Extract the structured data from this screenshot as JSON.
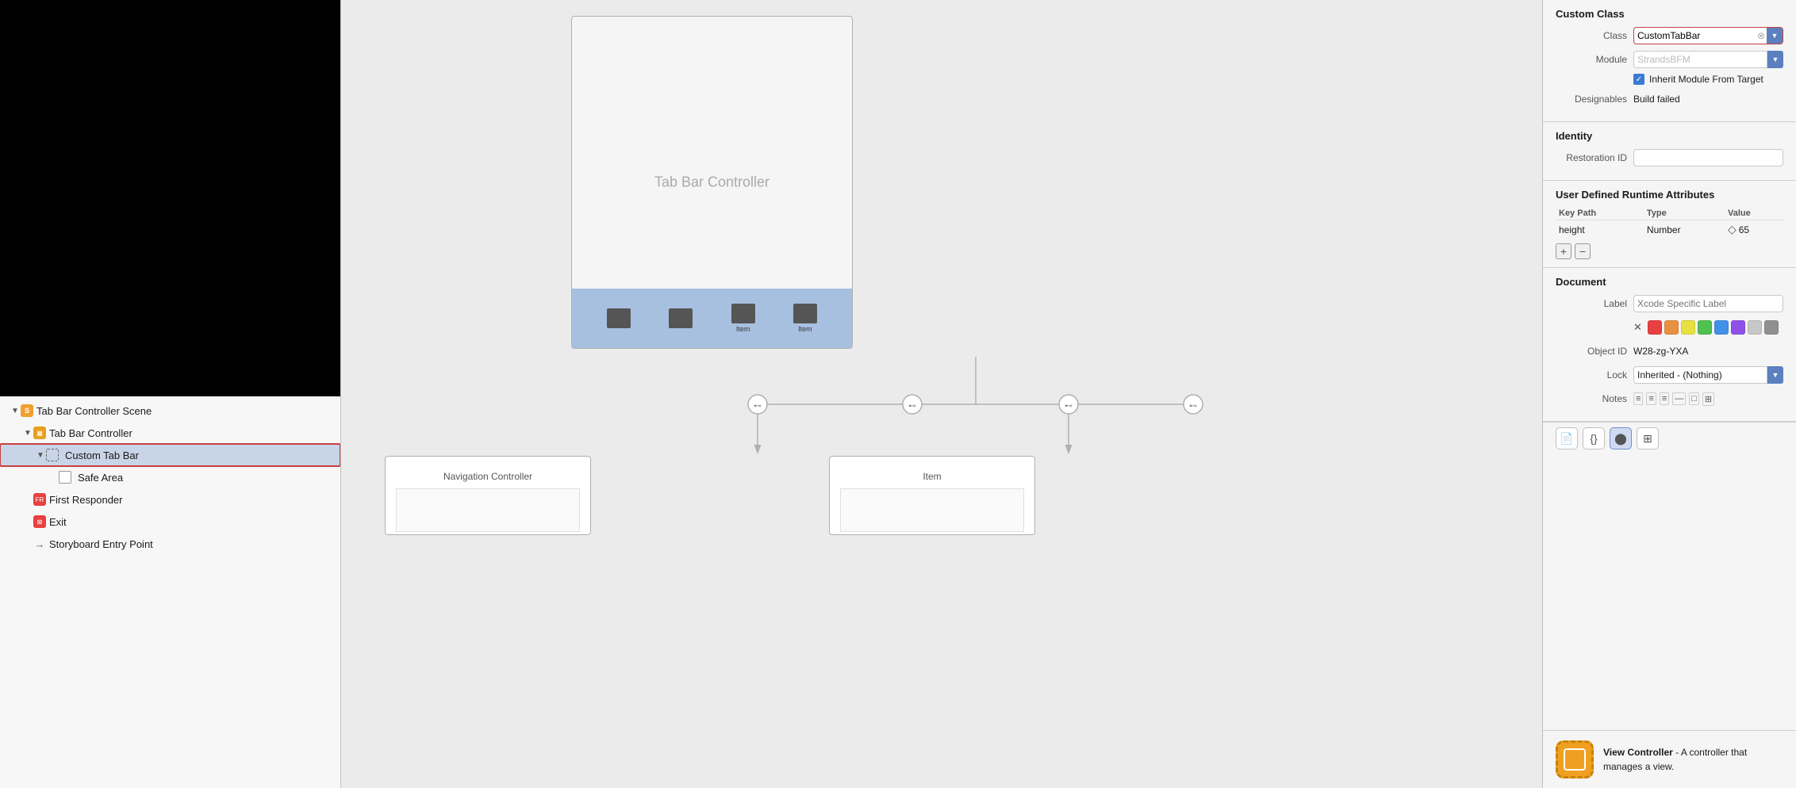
{
  "leftPanel": {
    "sceneTree": {
      "items": [
        {
          "id": "scene-root",
          "label": "Tab Bar Controller Scene",
          "indent": 1,
          "icon": "scene",
          "disclosure": "open",
          "selected": false
        },
        {
          "id": "tabbar-controller",
          "label": "Tab Bar Controller",
          "indent": 2,
          "icon": "tabbar",
          "disclosure": "open",
          "selected": false
        },
        {
          "id": "custom-tabbar",
          "label": "Custom Tab Bar",
          "indent": 3,
          "icon": "customtabbar",
          "disclosure": "open",
          "selected": true
        },
        {
          "id": "safe-area",
          "label": "Safe Area",
          "indent": 4,
          "icon": "safearea",
          "disclosure": "empty",
          "selected": false
        },
        {
          "id": "first-responder",
          "label": "First Responder",
          "indent": 2,
          "icon": "firstresponder",
          "disclosure": "empty",
          "selected": false
        },
        {
          "id": "exit",
          "label": "Exit",
          "indent": 2,
          "icon": "exit",
          "disclosure": "empty",
          "selected": false
        },
        {
          "id": "storyboard-entry",
          "label": "Storyboard Entry Point",
          "indent": 2,
          "icon": "arrow",
          "disclosure": "empty",
          "selected": false
        }
      ]
    }
  },
  "middleCanvas": {
    "controllerTitle": "Tab Bar Controller",
    "tabBarItems": [
      "Item",
      "Item"
    ],
    "subControllers": [
      {
        "title": "Navigation Controller"
      },
      {
        "title": "Item"
      }
    ]
  },
  "rightPanel": {
    "customClass": {
      "sectionTitle": "Custom Class",
      "classLabel": "Class",
      "classValue": "CustomTabBar",
      "moduleLabel": "Module",
      "modulePlaceholder": "StrandsBFM",
      "inheritCheckbox": "Inherit Module From Target",
      "designablesLabel": "Designables",
      "designablesValue": "Build failed"
    },
    "identity": {
      "sectionTitle": "Identity",
      "restorationLabel": "Restoration ID"
    },
    "userDefinedRuntime": {
      "sectionTitle": "User Defined Runtime Attributes",
      "columns": [
        "Key Path",
        "Type",
        "Value"
      ],
      "rows": [
        {
          "keyPath": "height",
          "type": "Number",
          "value": "◇ 65"
        }
      ]
    },
    "document": {
      "sectionTitle": "Document",
      "labelLabel": "Label",
      "labelPlaceholder": "Xcode Specific Label",
      "objectIdLabel": "Object ID",
      "objectIdValue": "W28-zg-YXA",
      "lockLabel": "Lock",
      "lockValue": "Inherited - (Nothing)",
      "notesLabel": "Notes",
      "swatchColors": [
        "#e84040",
        "#e89040",
        "#e8e040",
        "#50c050",
        "#4090e8",
        "#9050e8",
        "#c8c8c8",
        "#909090"
      ]
    },
    "viewController": {
      "title": "View Controller",
      "description": "A controller that manages a view."
    },
    "bottomIcons": [
      "📄",
      "{}",
      "🔵",
      "⊞"
    ]
  }
}
